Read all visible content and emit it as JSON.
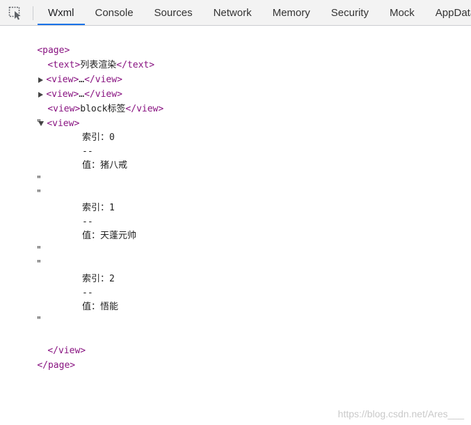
{
  "tabs": [
    "Wxml",
    "Console",
    "Sources",
    "Network",
    "Memory",
    "Security",
    "Mock",
    "AppData"
  ],
  "tree": {
    "page_open": "<page>",
    "text_open": "<text>",
    "text_content": "列表渲染",
    "text_close": "</text>",
    "view1_open": "<view>",
    "view1_ellipsis": "…",
    "view1_close": "</view>",
    "view2_open": "<view>",
    "view2_ellipsis": "…",
    "view2_close": "</view>",
    "view3_open": "<view>",
    "view3_content": "block标签",
    "view3_close": "</view>",
    "view4_open": "<view>",
    "quote": "\"",
    "items": [
      {
        "index": "索引：0",
        "sep": "--",
        "value": "值：猪八戒"
      },
      {
        "index": "索引：1",
        "sep": "--",
        "value": "值：天蓬元帅"
      },
      {
        "index": "索引：2",
        "sep": "--",
        "value": "值：悟能"
      }
    ],
    "view4_close": "</view>",
    "page_close": "</page>"
  },
  "watermark": "https://blog.csdn.net/Ares___"
}
